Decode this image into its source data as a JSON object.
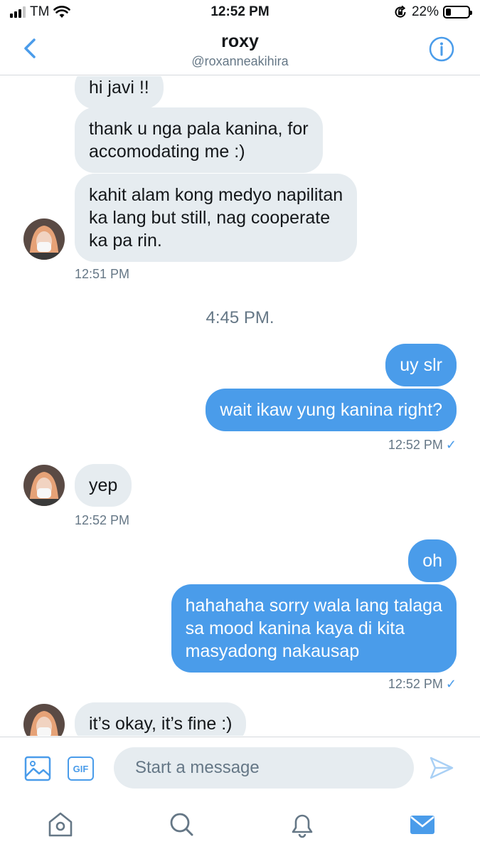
{
  "status_bar": {
    "carrier": "TM",
    "time": "12:52 PM",
    "battery": "22%",
    "battery_level": 0.22,
    "icons": [
      "signal-icon",
      "wifi-icon",
      "rotation-lock-icon",
      "battery-icon"
    ]
  },
  "header": {
    "name": "roxy",
    "handle": "@roxanneakihira",
    "back_icon": "chevron-left-icon",
    "info_icon": "info-icon"
  },
  "colors": {
    "accent": "#4a9cea",
    "incoming_bubble": "#e6ecf0",
    "muted_text": "#657786",
    "divider": "#d5d9dd"
  },
  "messages": {
    "m1": "hi javi !!",
    "m2_l1": "thank u nga pala kanina, for",
    "m2_l2": "accomodating me :)",
    "m3_l1": "kahit alam kong medyo napilitan",
    "m3_l2": "ka lang but still, nag cooperate",
    "m3_l3": "ka pa rin.",
    "ts1": "12:51 PM",
    "separator": "4:45 PM.",
    "m4": "uy slr",
    "m5": "wait ikaw yung kanina right?",
    "ts2": "12:52 PM",
    "m6": "yep",
    "ts3": "12:52 PM",
    "m7": "oh",
    "m8_l1": "hahahaha sorry wala lang talaga",
    "m8_l2": "sa mood kanina kaya di kita",
    "m8_l3": "masyadong nakausap",
    "ts4": "12:52 PM",
    "m9": "it’s okay, it’s fine :)",
    "read_mark": "✓"
  },
  "composer": {
    "placeholder": "Start a message",
    "gif_label": "GIF",
    "icons": [
      "image-icon",
      "gif-icon",
      "send-icon"
    ]
  },
  "tab_bar": {
    "items": [
      "home-icon",
      "search-icon",
      "notifications-icon",
      "messages-icon"
    ],
    "active": "messages-icon"
  }
}
